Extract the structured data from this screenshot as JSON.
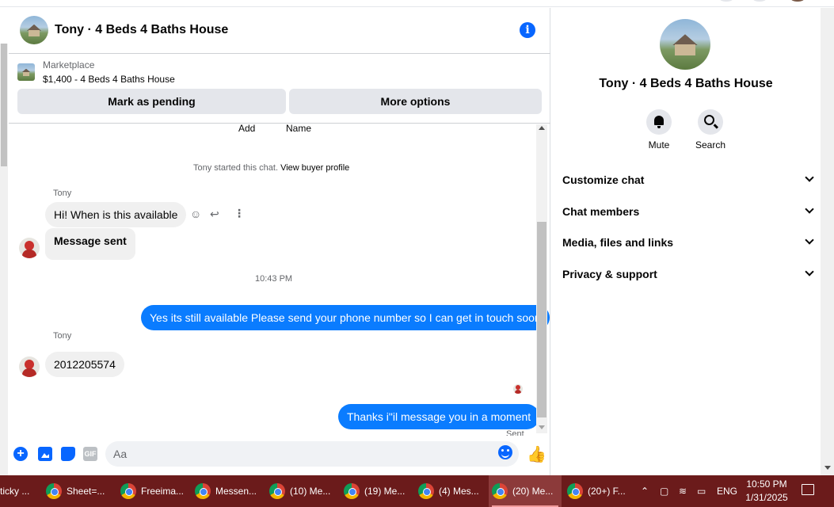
{
  "chat": {
    "title": "Tony · 4 Beds 4 Baths House",
    "marketplace_label": "Marketplace",
    "listing": "$1,400 - 4 Beds 4 Baths House",
    "buttons": {
      "pending": "Mark as pending",
      "more": "More options"
    },
    "add_label": "Add",
    "name_label": "Name",
    "system_text": "Tony started this chat.",
    "view_profile": "View buyer profile",
    "messages": [
      {
        "sender": "Tony",
        "text": "Hi!  When is this available"
      },
      {
        "text": "Message sent"
      },
      {
        "timestamp": "10:43 PM"
      },
      {
        "text": "Yes its still available Please send your phone number so I can get in touch soon"
      },
      {
        "sender": "Tony",
        "text": "2012205574"
      },
      {
        "text": "Thanks i\"il message you in a moment"
      },
      {
        "status": "Sent"
      }
    ],
    "composer_placeholder": "Aa",
    "gif_label": "GIF"
  },
  "info_panel": {
    "title": "Tony · 4 Beds 4 Baths House",
    "actions": [
      {
        "label": "Mute",
        "icon": "bell-icon"
      },
      {
        "label": "Search",
        "icon": "search-icon"
      }
    ],
    "sections": [
      "Customize chat",
      "Chat members",
      "Media, files and links",
      "Privacy & support"
    ]
  },
  "taskbar": {
    "items": [
      {
        "label": "ticky ...",
        "active": false
      },
      {
        "label": "Sheet=...",
        "active": false
      },
      {
        "label": "Freeima...",
        "active": false
      },
      {
        "label": "Messen...",
        "active": false
      },
      {
        "label": "(10) Me...",
        "active": false
      },
      {
        "label": "(19) Me...",
        "active": false
      },
      {
        "label": "(4) Mes...",
        "active": false
      },
      {
        "label": "(20) Me...",
        "active": true
      },
      {
        "label": "(20+) F...",
        "active": false
      }
    ],
    "language": "ENG",
    "time": "10:50 PM",
    "date": "1/31/2025"
  },
  "colors": {
    "accent": "#0866ff",
    "outgoing_bubble": "#0a7cff",
    "taskbar": "#6b1b1b"
  }
}
